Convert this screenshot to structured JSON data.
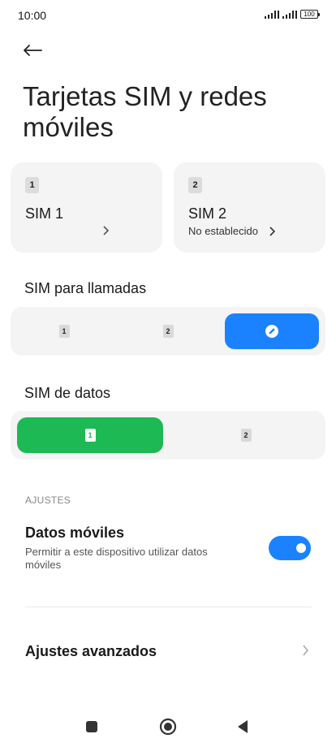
{
  "status_bar": {
    "time": "10:00",
    "battery": "100"
  },
  "header": {
    "back_icon": "arrow-left-icon",
    "title": "Tarjetas SIM y redes móviles"
  },
  "sim_cards": [
    {
      "badge": "1",
      "name": "SIM 1",
      "subtitle": ""
    },
    {
      "badge": "2",
      "name": "SIM 2",
      "subtitle": "No establecido"
    }
  ],
  "calls": {
    "label": "SIM para llamadas",
    "options": [
      {
        "badge": "1"
      },
      {
        "badge": "2"
      },
      {
        "icon": "pencil-icon",
        "selected": true
      }
    ],
    "accent": "#1a82ff"
  },
  "data_sim": {
    "label": "SIM de datos",
    "options": [
      {
        "badge": "1",
        "selected": true
      },
      {
        "badge": "2"
      }
    ],
    "accent": "#1db954"
  },
  "settings": {
    "section_label": "AJUSTES",
    "mobile_data": {
      "title": "Datos móviles",
      "description": "Permitir a este dispositivo utilizar datos móviles",
      "enabled": true
    },
    "advanced": {
      "title": "Ajustes avanzados"
    }
  },
  "nav": {
    "items": [
      "square-recents-icon",
      "circle-home-icon",
      "triangle-back-icon"
    ]
  }
}
